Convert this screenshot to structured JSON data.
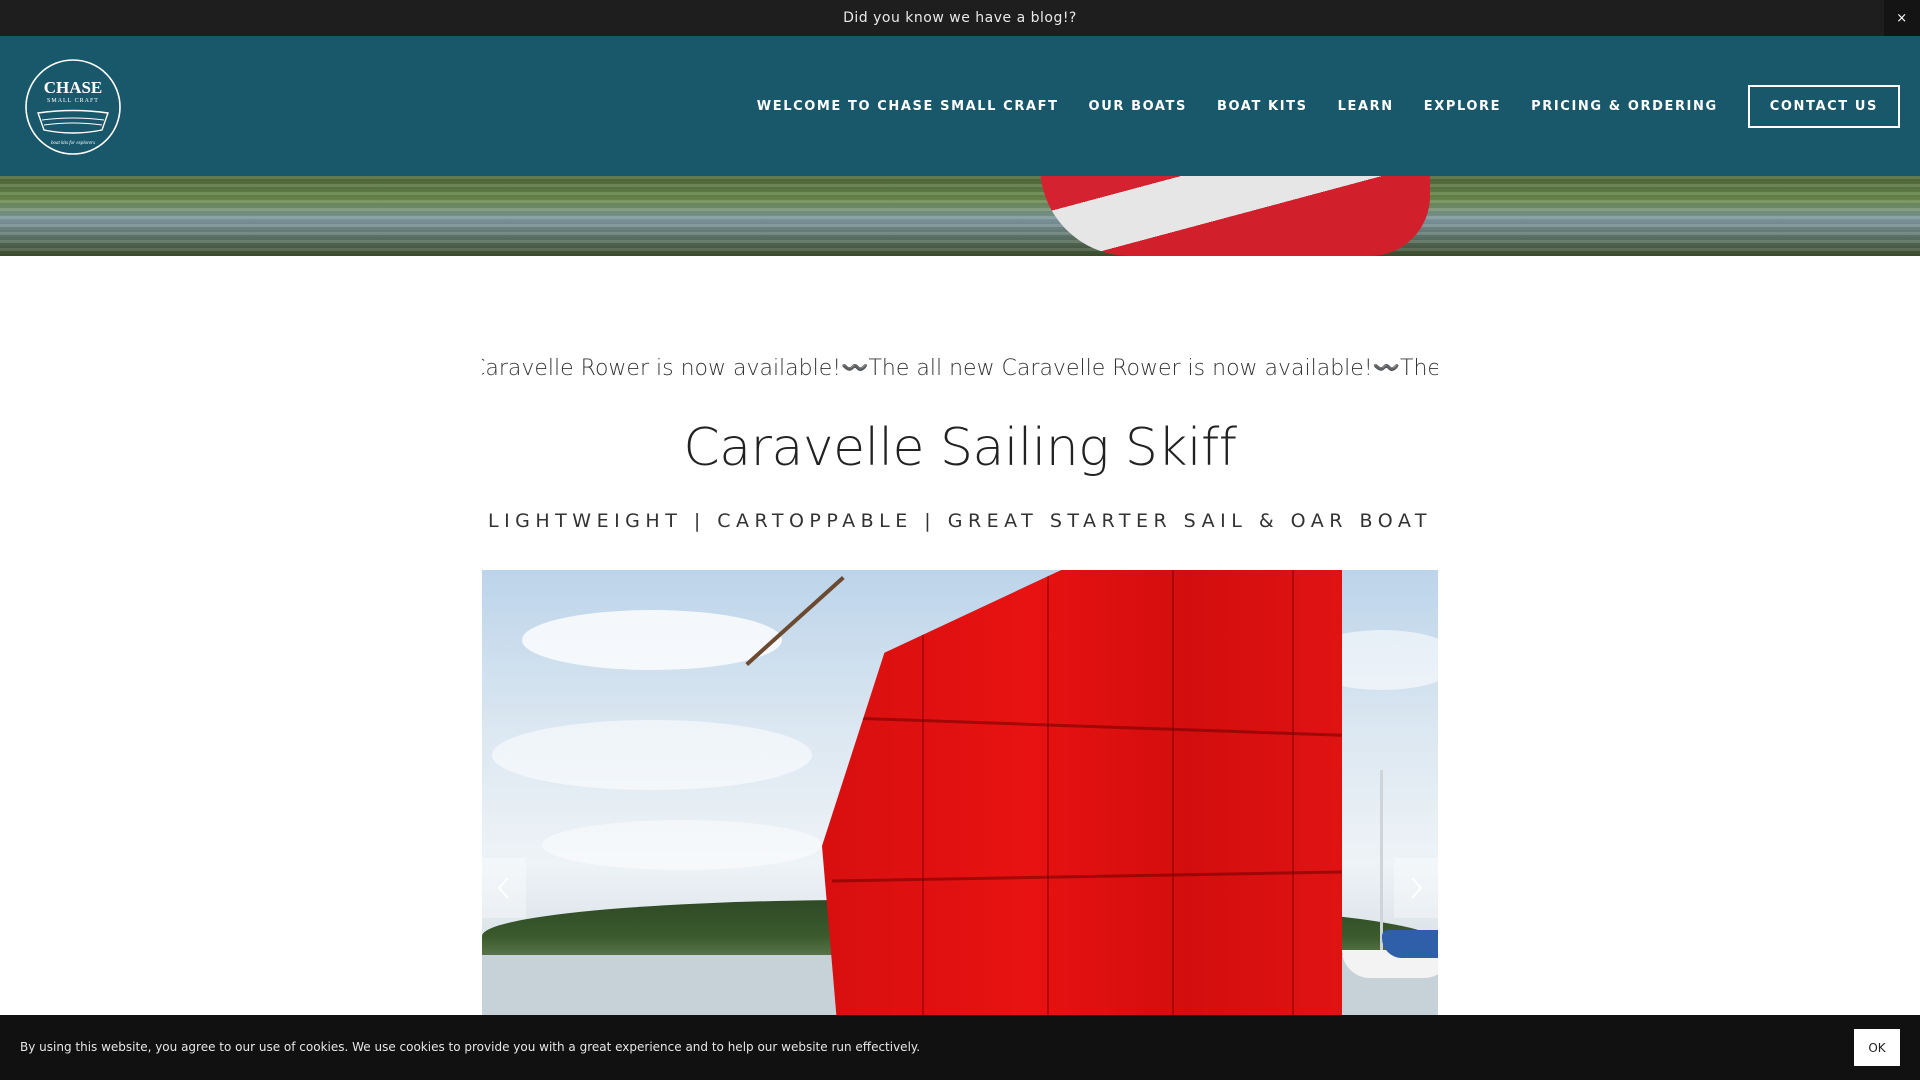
{
  "announcement": {
    "text": "Did you know we have a blog!?",
    "close_label": "×"
  },
  "header": {
    "logo": {
      "title": "CHASE",
      "subtitle": "SMALL CRAFT",
      "tagline": "boat kits for explorers"
    },
    "nav": [
      {
        "label": "WELCOME TO CHASE SMALL CRAFT"
      },
      {
        "label": "OUR BOATS"
      },
      {
        "label": "BOAT KITS"
      },
      {
        "label": "LEARN"
      },
      {
        "label": "EXPLORE"
      },
      {
        "label": "PRICING & ORDERING"
      }
    ],
    "cta_label": "CONTACT US"
  },
  "ticker": {
    "segments": [
      "Caravelle Rower is now available!",
      "The all new Caravelle Rower is now available!",
      "The all new Caravel"
    ],
    "separator": "〰️"
  },
  "main": {
    "title": "Caravelle Sailing Skiff",
    "subtitle": "LIGHTWEIGHT | CARTOPPABLE | GREAT STARTER SAIL & OAR BOAT"
  },
  "slideshow": {
    "prev_icon": "chevron-left-icon",
    "next_icon": "chevron-right-icon"
  },
  "cookie": {
    "text": "By using this website, you agree to our use of cookies. We use cookies to provide you with a great experience and to help our website run effectively.",
    "ok_label": "OK"
  },
  "colors": {
    "header_bg": "#19576a",
    "announce_bg": "#1e1e1e",
    "cookie_bg": "#111111",
    "sail_red": "#e01313"
  }
}
